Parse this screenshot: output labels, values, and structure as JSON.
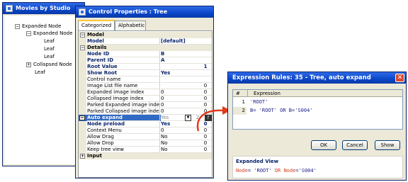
{
  "movies_window": {
    "title": "Movies by Studio",
    "tree": [
      {
        "label": "Expanded Node",
        "toggle": "−"
      },
      {
        "label": "Expanded Node",
        "toggle": "−"
      },
      {
        "label": "Leaf"
      },
      {
        "label": "Leaf"
      },
      {
        "label": "Leaf"
      },
      {
        "label": "Collapsed Node",
        "toggle": "+"
      },
      {
        "label": "Leaf"
      }
    ]
  },
  "props_window": {
    "title": "Control Properties : Tree",
    "tabs": [
      "Categorized",
      "Alphabetic"
    ],
    "active_tab": "Categorized",
    "sections": {
      "model": "Model",
      "details": "Details",
      "input": "Input"
    },
    "rows": [
      {
        "name": "Model",
        "value": "[default]",
        "value2": ""
      },
      {
        "name": "Node ID",
        "value": "B",
        "value2": ""
      },
      {
        "name": "Parent ID",
        "value": "A",
        "value2": ""
      },
      {
        "name": "Root Value",
        "value": "",
        "value2": "1"
      },
      {
        "name": "Show Root",
        "value": "Yes",
        "value2": ""
      },
      {
        "name": "Control name",
        "value": "",
        "value2": ""
      },
      {
        "name": "Image List file name",
        "value": "",
        "value2": "0"
      },
      {
        "name": "Expanded image index",
        "value": "0",
        "value2": "0"
      },
      {
        "name": "Collapsed image index",
        "value": "0",
        "value2": "0"
      },
      {
        "name": "Parked Expanded image index",
        "value": "0",
        "value2": "0"
      },
      {
        "name": "Parked Collapsed image index",
        "value": "0",
        "value2": "0"
      },
      {
        "name": "Auto expand",
        "value": "Yes",
        "value2": "2"
      },
      {
        "name": "Node preload",
        "value": "Yes",
        "value2": "0"
      },
      {
        "name": "Context Menu",
        "value": "0",
        "value2": "0"
      },
      {
        "name": "Allow Drag",
        "value": "No",
        "value2": "0"
      },
      {
        "name": "Allow Drop",
        "value": "No",
        "value2": "0"
      },
      {
        "name": "Keep tree view",
        "value": "No",
        "value2": "0"
      }
    ],
    "dropdown_icon": "chevron-down-icon",
    "expression_icon": "expression-editor-icon"
  },
  "expr_window": {
    "title": "Expression Rules: 35 -   Tree, auto expand",
    "columns": [
      "#",
      "Expression"
    ],
    "rows": [
      {
        "num": "1",
        "expr": "'ROOT'"
      },
      {
        "num": "2",
        "expr": "B= 'ROOT' OR B='S004'"
      }
    ],
    "buttons": {
      "ok": "OK",
      "cancel": "Cancel",
      "show": "Show"
    },
    "expanded_view": {
      "heading": "Expanded View",
      "parts": [
        "Node",
        "= 'ROOT' ",
        "OR",
        " ",
        "Node",
        "='S004'"
      ]
    }
  },
  "colors": {
    "titlebar": "#0b46c8",
    "selection": "#316ac5",
    "arrow": "#e03a1a",
    "keyword": "#d43c1a"
  }
}
